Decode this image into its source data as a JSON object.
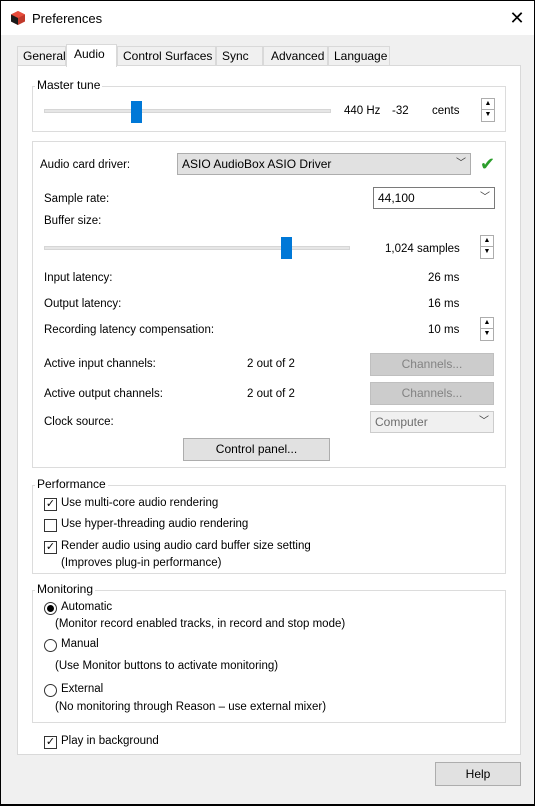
{
  "window": {
    "title": "Preferences",
    "close_glyph": "✕"
  },
  "tabs": [
    {
      "label": "General"
    },
    {
      "label": "Audio"
    },
    {
      "label": "Control Surfaces"
    },
    {
      "label": "Sync"
    },
    {
      "label": "Advanced"
    },
    {
      "label": "Language"
    }
  ],
  "master_tune": {
    "title": "Master tune",
    "frequency": "440 Hz",
    "cents_value": "-32",
    "cents_unit": "cents",
    "slider_level": 0.32
  },
  "audio": {
    "driver_label": "Audio card driver:",
    "driver_value": "ASIO AudioBox ASIO Driver",
    "driver_status_icon": "checkmark-icon",
    "sample_rate_label": "Sample rate:",
    "sample_rate_value": "44,100",
    "buffer_size_label": "Buffer size:",
    "buffer_size_value": "1,024 samples",
    "buffer_slider_level": 0.79,
    "input_latency_label": "Input latency:",
    "input_latency_value": "26 ms",
    "output_latency_label": "Output latency:",
    "output_latency_value": "16 ms",
    "rec_comp_label": "Recording latency compensation:",
    "rec_comp_value": "10 ms",
    "input_channels_label": "Active input channels:",
    "input_channels_value": "2 out of 2",
    "input_channels_button": "Channels...",
    "output_channels_label": "Active output channels:",
    "output_channels_value": "2 out of 2",
    "output_channels_button": "Channels...",
    "clock_source_label": "Clock source:",
    "clock_source_value": "Computer",
    "control_panel_button": "Control panel..."
  },
  "performance": {
    "title": "Performance",
    "multicore_label": "Use multi-core audio rendering",
    "hyperthreading_label": "Use hyper-threading audio rendering",
    "buffer_render_label": "Render audio using audio card buffer size setting",
    "buffer_render_note": "(Improves plug-in performance)"
  },
  "monitoring": {
    "title": "Monitoring",
    "automatic_label": "Automatic",
    "automatic_note": "(Monitor record enabled tracks, in record and stop mode)",
    "manual_label": "Manual",
    "manual_note": "(Use Monitor buttons to activate monitoring)",
    "external_label": "External",
    "external_note": "(No monitoring through Reason – use external mixer)"
  },
  "play_in_background_label": "Play in background",
  "help_button": "Help"
}
